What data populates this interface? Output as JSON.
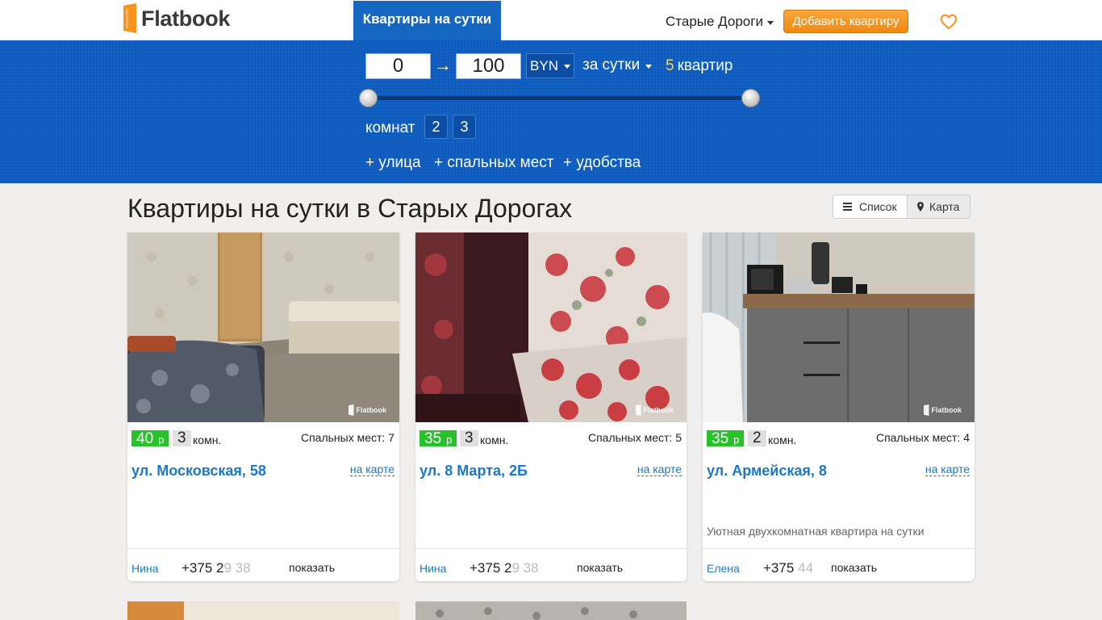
{
  "header": {
    "logo_text": "Flatbook",
    "nav_tab": "Квартиры на сутки",
    "city": "Старые Дороги",
    "add_button": "Добавить квартиру",
    "favorites_icon": "heart-icon"
  },
  "filter": {
    "price_min": "0",
    "price_max": "100",
    "arrow": "→",
    "currency": "BYN",
    "period": "за сутки",
    "count_num": "5",
    "count_label": "квартир",
    "rooms_label": "комнат",
    "rooms_options": [
      "2",
      "3"
    ],
    "more_links": [
      "+ улица",
      "+ спальных мест",
      "+ удобства"
    ]
  },
  "content": {
    "title": "Квартиры на сутки в Старых Дорогах",
    "view_list": "Список",
    "view_map": "Карта"
  },
  "listings": [
    {
      "price": "40",
      "currency": "р",
      "rooms": "3",
      "rooms_label": "комн.",
      "beds": "Спальных мест: 7",
      "address": "ул. Московская, 58",
      "map_link": "на карте",
      "description": "",
      "owner": "Нина",
      "phone_visible": "+375 2",
      "phone_faded": "9 38",
      "show": "показать",
      "watermark": "Flatbook"
    },
    {
      "price": "35",
      "currency": "р",
      "rooms": "3",
      "rooms_label": "комн.",
      "beds": "Спальных мест: 5",
      "address": "ул. 8 Марта, 2Б",
      "map_link": "на карте",
      "description": "",
      "owner": "Нина",
      "phone_visible": "+375 2",
      "phone_faded": "9 38",
      "show": "показать",
      "watermark": "Flatbook"
    },
    {
      "price": "35",
      "currency": "р",
      "rooms": "2",
      "rooms_label": "комн.",
      "beds": "Спальных мест: 4",
      "address": "ул. Армейская, 8",
      "map_link": "на карте",
      "description": "Уютная двухкомнатная квартира на сутки",
      "owner": "Елена",
      "phone_visible": "+375",
      "phone_faded": " 44",
      "show": "показать",
      "watermark": "Flatbook"
    }
  ]
}
